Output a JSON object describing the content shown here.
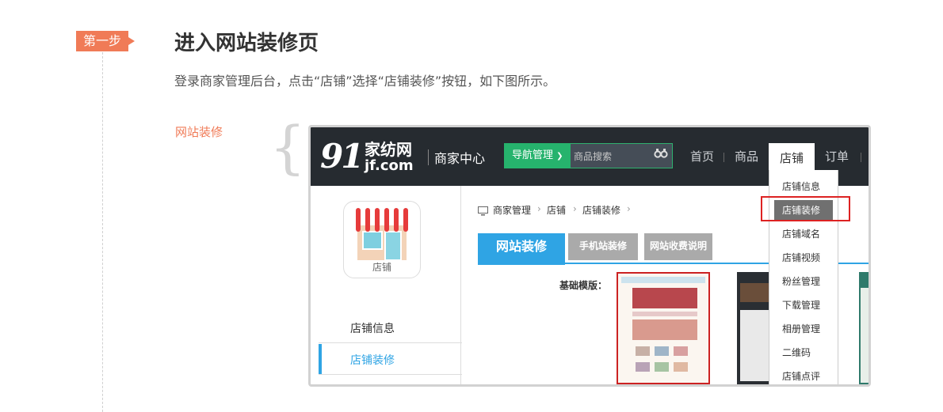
{
  "step": {
    "badge": "第一步",
    "title": "进入网站装修页",
    "description": "登录商家管理后台，点击“店铺”选择“店铺装修”按钮，如下图所示。"
  },
  "section_label": "网站装修",
  "screenshot": {
    "logo": {
      "number": "91",
      "chinese": "家纺网",
      "domain": "jf.com"
    },
    "merchant_center": "商家中心",
    "nav_button": "导航管理",
    "search_placeholder": "商品搜索",
    "menu": [
      "首页",
      "商品",
      "店铺",
      "订单"
    ],
    "dropdown": [
      "店铺信息",
      "店铺装修",
      "店铺域名",
      "店铺视频",
      "粉丝管理",
      "下载管理",
      "相册管理",
      "二维码",
      "店铺点评"
    ],
    "breadcrumb": [
      "商家管理",
      "店铺",
      "店铺装修"
    ],
    "tabs": [
      "网站装修",
      "手机站装修",
      "网站收费说明"
    ],
    "template_label": "基础模版：",
    "sidebar": {
      "icon_label": "店铺",
      "items": [
        "店铺信息",
        "店铺装修"
      ]
    },
    "colors": {
      "topbar": "#262b30",
      "green": "#26b36d",
      "blue": "#2fa4e4",
      "highlight_red": "#dd2222",
      "accent_orange": "#f07b57"
    }
  }
}
